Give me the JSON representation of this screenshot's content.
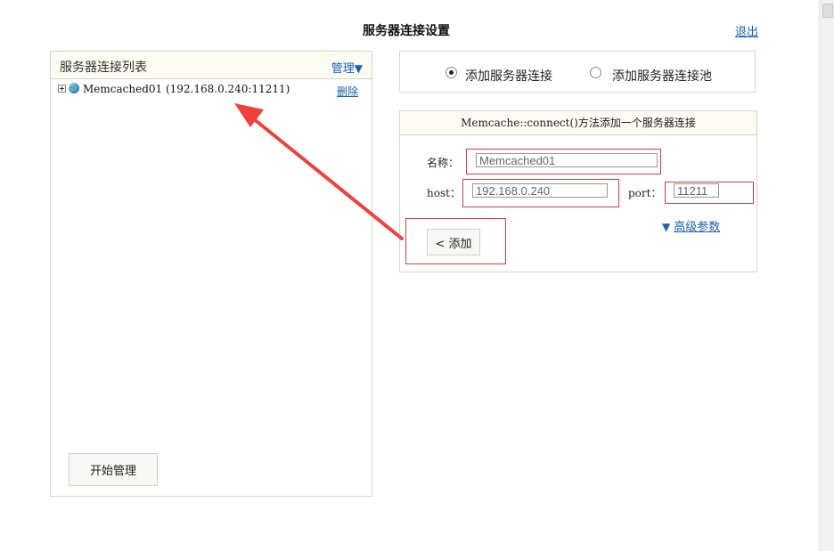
{
  "page": {
    "title": "服务器连接设置",
    "logout_label": "退出"
  },
  "left_panel": {
    "title": "服务器连接列表",
    "manage_label": "管理",
    "manage_arrow": "▼",
    "servers": [
      {
        "label": "Memcached01  (192.168.0.240:11211)",
        "delete_label": "删除"
      }
    ],
    "start_button_label": "开始管理"
  },
  "mode_options": {
    "options": [
      {
        "label": "添加服务器连接",
        "checked": true
      },
      {
        "label": "添加服务器连接池",
        "checked": false
      }
    ]
  },
  "form": {
    "header": "Memcache::connect()方法添加一个服务器连接",
    "name_label": "名称：",
    "name_value": "Memcached01",
    "host_label": "host：",
    "host_value": "192.168.0.240",
    "port_label": "port：",
    "port_value": "11211",
    "advanced_arrow": "▼",
    "advanced_label": "高级参数",
    "add_button_label": "< 添加"
  },
  "colors": {
    "link": "#1a5fb4",
    "annotation_red": "#e03a3a",
    "panel_border": "#d9d6c3"
  }
}
